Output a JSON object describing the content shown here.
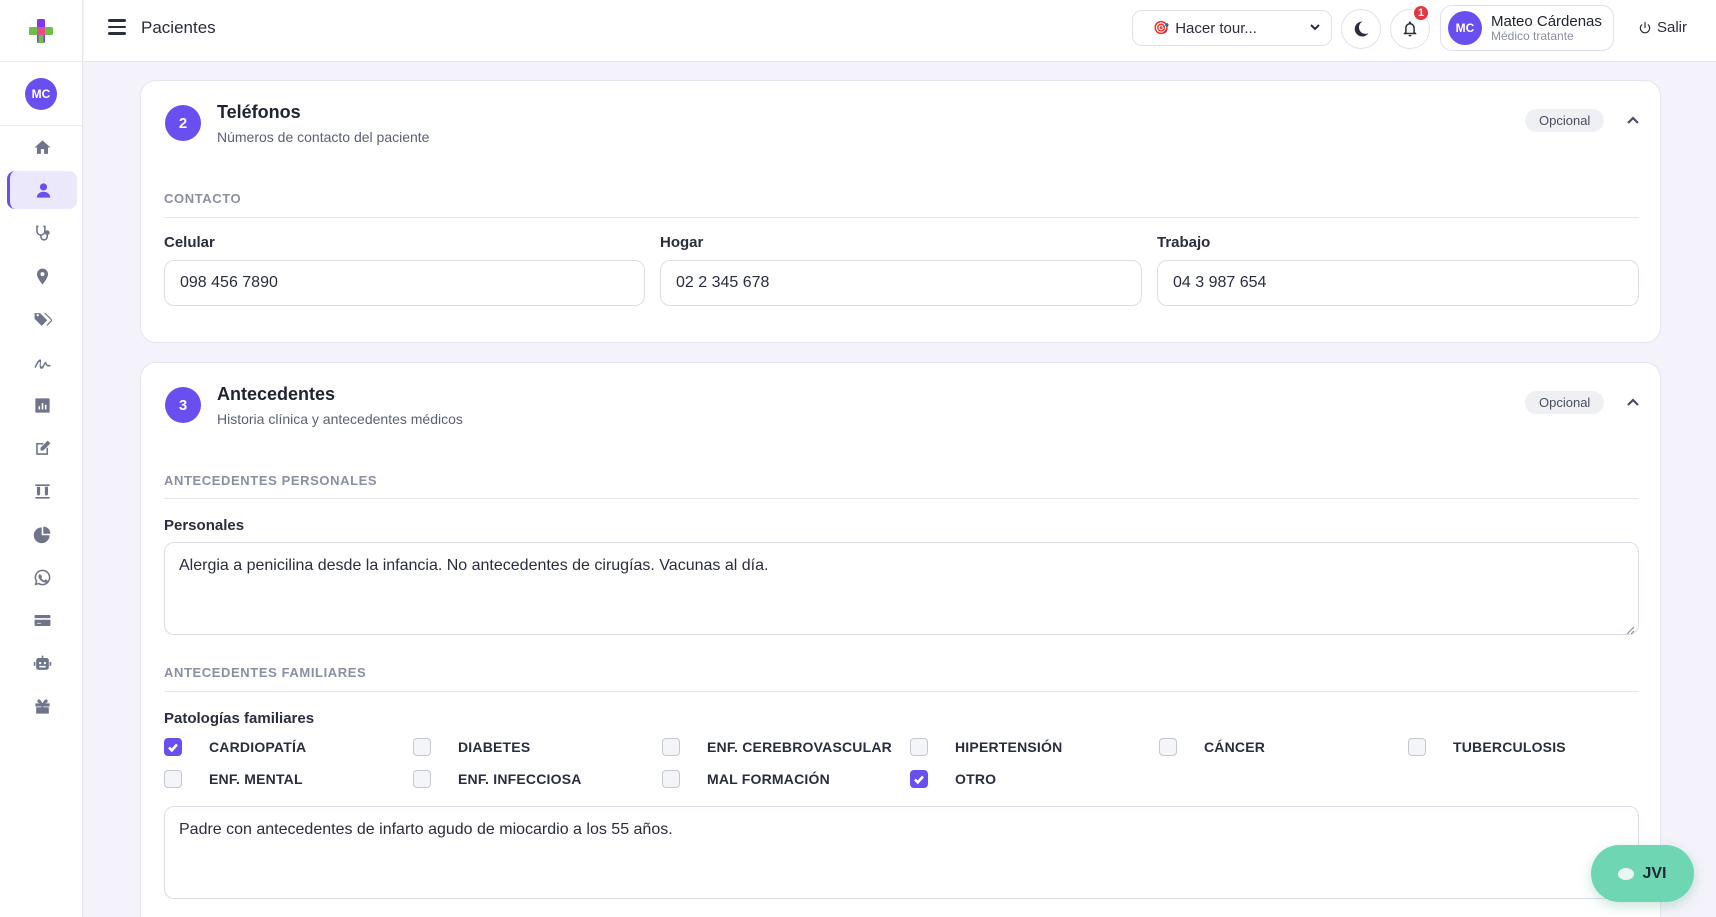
{
  "app": {
    "page_title": "Pacientes"
  },
  "sidebar": {
    "avatar_initials": "MC",
    "items": [
      {
        "icon": "home-icon"
      },
      {
        "icon": "user-icon",
        "active": true
      },
      {
        "icon": "stethoscope-icon"
      },
      {
        "icon": "location-icon"
      },
      {
        "icon": "tags-icon"
      },
      {
        "icon": "signature-icon"
      },
      {
        "icon": "chart-icon"
      },
      {
        "icon": "edit-icon"
      },
      {
        "icon": "lab-tubes-icon"
      },
      {
        "icon": "pie-chart-icon"
      },
      {
        "icon": "whatsapp-icon"
      },
      {
        "icon": "credit-card-icon"
      },
      {
        "icon": "robot-icon"
      },
      {
        "icon": "gift-icon"
      }
    ]
  },
  "topbar": {
    "tour_select": "Hacer tour...",
    "notifications_count": "1",
    "user": {
      "initials": "MC",
      "name": "Mateo Cárdenas",
      "role": "Médico tratante"
    },
    "logout_label": "Salir"
  },
  "telefonos": {
    "number": "2",
    "title": "Teléfonos",
    "subtitle": "Números de contacto del paciente",
    "badge": "Opcional",
    "section": "CONTACTO",
    "fields": {
      "celular": {
        "label": "Celular",
        "value": "098 456 7890"
      },
      "hogar": {
        "label": "Hogar",
        "value": "02 2 345 678"
      },
      "trabajo": {
        "label": "Trabajo",
        "value": "04 3 987 654"
      }
    }
  },
  "antecedentes": {
    "number": "3",
    "title": "Antecedentes",
    "subtitle": "Historia clínica y antecedentes médicos",
    "badge": "Opcional",
    "personal_section": "ANTECEDENTES PERSONALES",
    "personal_label": "Personales",
    "personal_text": "Alergia a penicilina desde la infancia. No antecedentes de cirugías. Vacunas al día.",
    "family_section": "ANTECEDENTES FAMILIARES",
    "family_label": "Patologías familiares",
    "pathologies": [
      {
        "label": "CARDIOPATÍA",
        "checked": true
      },
      {
        "label": "DIABETES",
        "checked": false
      },
      {
        "label": "ENF. CEREBROVASCULAR",
        "checked": false
      },
      {
        "label": "HIPERTENSIÓN",
        "checked": false
      },
      {
        "label": "CÁNCER",
        "checked": false
      },
      {
        "label": "TUBERCULOSIS",
        "checked": false
      },
      {
        "label": "ENF. MENTAL",
        "checked": false
      },
      {
        "label": "ENF. INFECCIOSA",
        "checked": false
      },
      {
        "label": "MAL FORMACIÓN",
        "checked": false
      },
      {
        "label": "OTRO",
        "checked": true
      }
    ],
    "family_text": "Padre con antecedentes de infarto agudo de miocardio a los 55 años."
  },
  "assistant": {
    "label": "JVI"
  },
  "colors": {
    "accent": "#6a4ff0",
    "notification": "#e5363f",
    "assistant": "#6fd6b3"
  }
}
